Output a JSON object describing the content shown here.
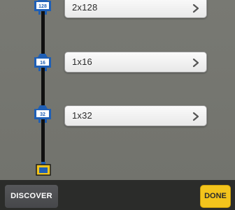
{
  "splitter_list": {
    "items": [
      {
        "label": "2x128",
        "badge": "128"
      },
      {
        "label": "1x16",
        "badge": "16"
      },
      {
        "label": "1x32",
        "badge": "32"
      }
    ]
  },
  "footer": {
    "discover_label": "DISCOVER",
    "done_label": "DONE"
  },
  "colors": {
    "splitter_blue": "#1f5fb5",
    "done_yellow": "#f3c41c",
    "bottom_bar": "#2b2c2a",
    "content_bg": "#72736d"
  },
  "icons": {
    "splitter": "splitter-icon",
    "onu": "onu-icon",
    "chevron": "chevron-right-icon"
  }
}
